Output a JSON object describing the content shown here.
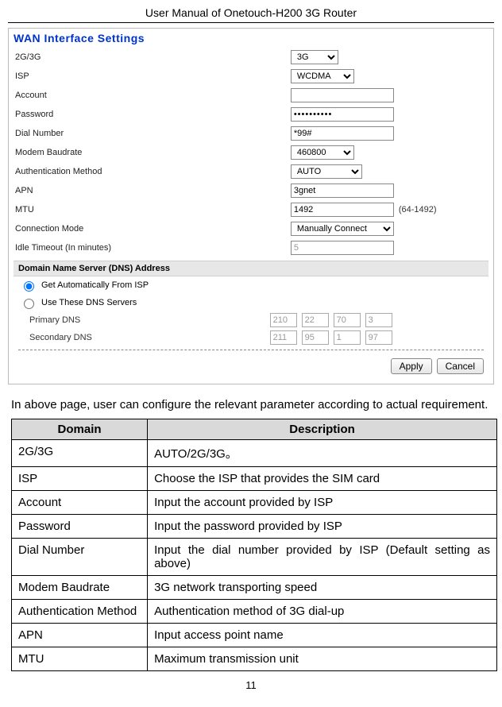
{
  "header": "User Manual of Onetouch-H200 3G Router",
  "embed": {
    "title": "WAN Interface Settings",
    "rows": {
      "g23_label": "2G/3G",
      "g23_value": "3G",
      "isp_label": "ISP",
      "isp_value": "WCDMA",
      "account_label": "Account",
      "account_value": "",
      "password_label": "Password",
      "password_value": "••••••••••",
      "dial_label": "Dial Number",
      "dial_value": "*99#",
      "baud_label": "Modem Baudrate",
      "baud_value": "460800",
      "auth_label": "Authentication Method",
      "auth_value": "AUTO",
      "apn_label": "APN",
      "apn_value": "3gnet",
      "mtu_label": "MTU",
      "mtu_value": "1492",
      "mtu_hint": "(64-1492)",
      "conn_label": "Connection Mode",
      "conn_value": "Manually Connect",
      "idle_label": "Idle Timeout (In minutes)",
      "idle_value": "5"
    },
    "dns": {
      "header": "Domain Name Server (DNS) Address",
      "opt_auto": "Get Automatically From ISP",
      "opt_manual": "Use These DNS Servers",
      "primary_label": "Primary DNS",
      "secondary_label": "Secondary DNS",
      "primary": [
        "210",
        "22",
        "70",
        "3"
      ],
      "secondary": [
        "211",
        "95",
        "1",
        "97"
      ]
    },
    "buttons": {
      "apply": "Apply",
      "cancel": "Cancel"
    }
  },
  "paragraph": "In above page, user can configure the relevant parameter according to actual requirement.",
  "table": {
    "head_domain": "Domain",
    "head_desc": "Description",
    "rows": [
      {
        "d": "2G/3G",
        "t": "AUTO/2G/3G。"
      },
      {
        "d": "ISP",
        "t": "Choose the ISP that provides the SIM card"
      },
      {
        "d": "Account",
        "t": "Input the account provided by ISP"
      },
      {
        "d": "Password",
        "t": "Input the password provided by ISP"
      },
      {
        "d": "Dial Number",
        "t": "Input the dial number provided by ISP (Default setting as above)",
        "justify": true
      },
      {
        "d": "Modem Baudrate",
        "t": "3G network transporting speed"
      },
      {
        "d": "Authentication Method",
        "t": "Authentication method of 3G dial-up"
      },
      {
        "d": "APN",
        "t": "Input access point name"
      },
      {
        "d": "MTU",
        "t": "Maximum transmission unit"
      }
    ]
  },
  "page_number": "11"
}
